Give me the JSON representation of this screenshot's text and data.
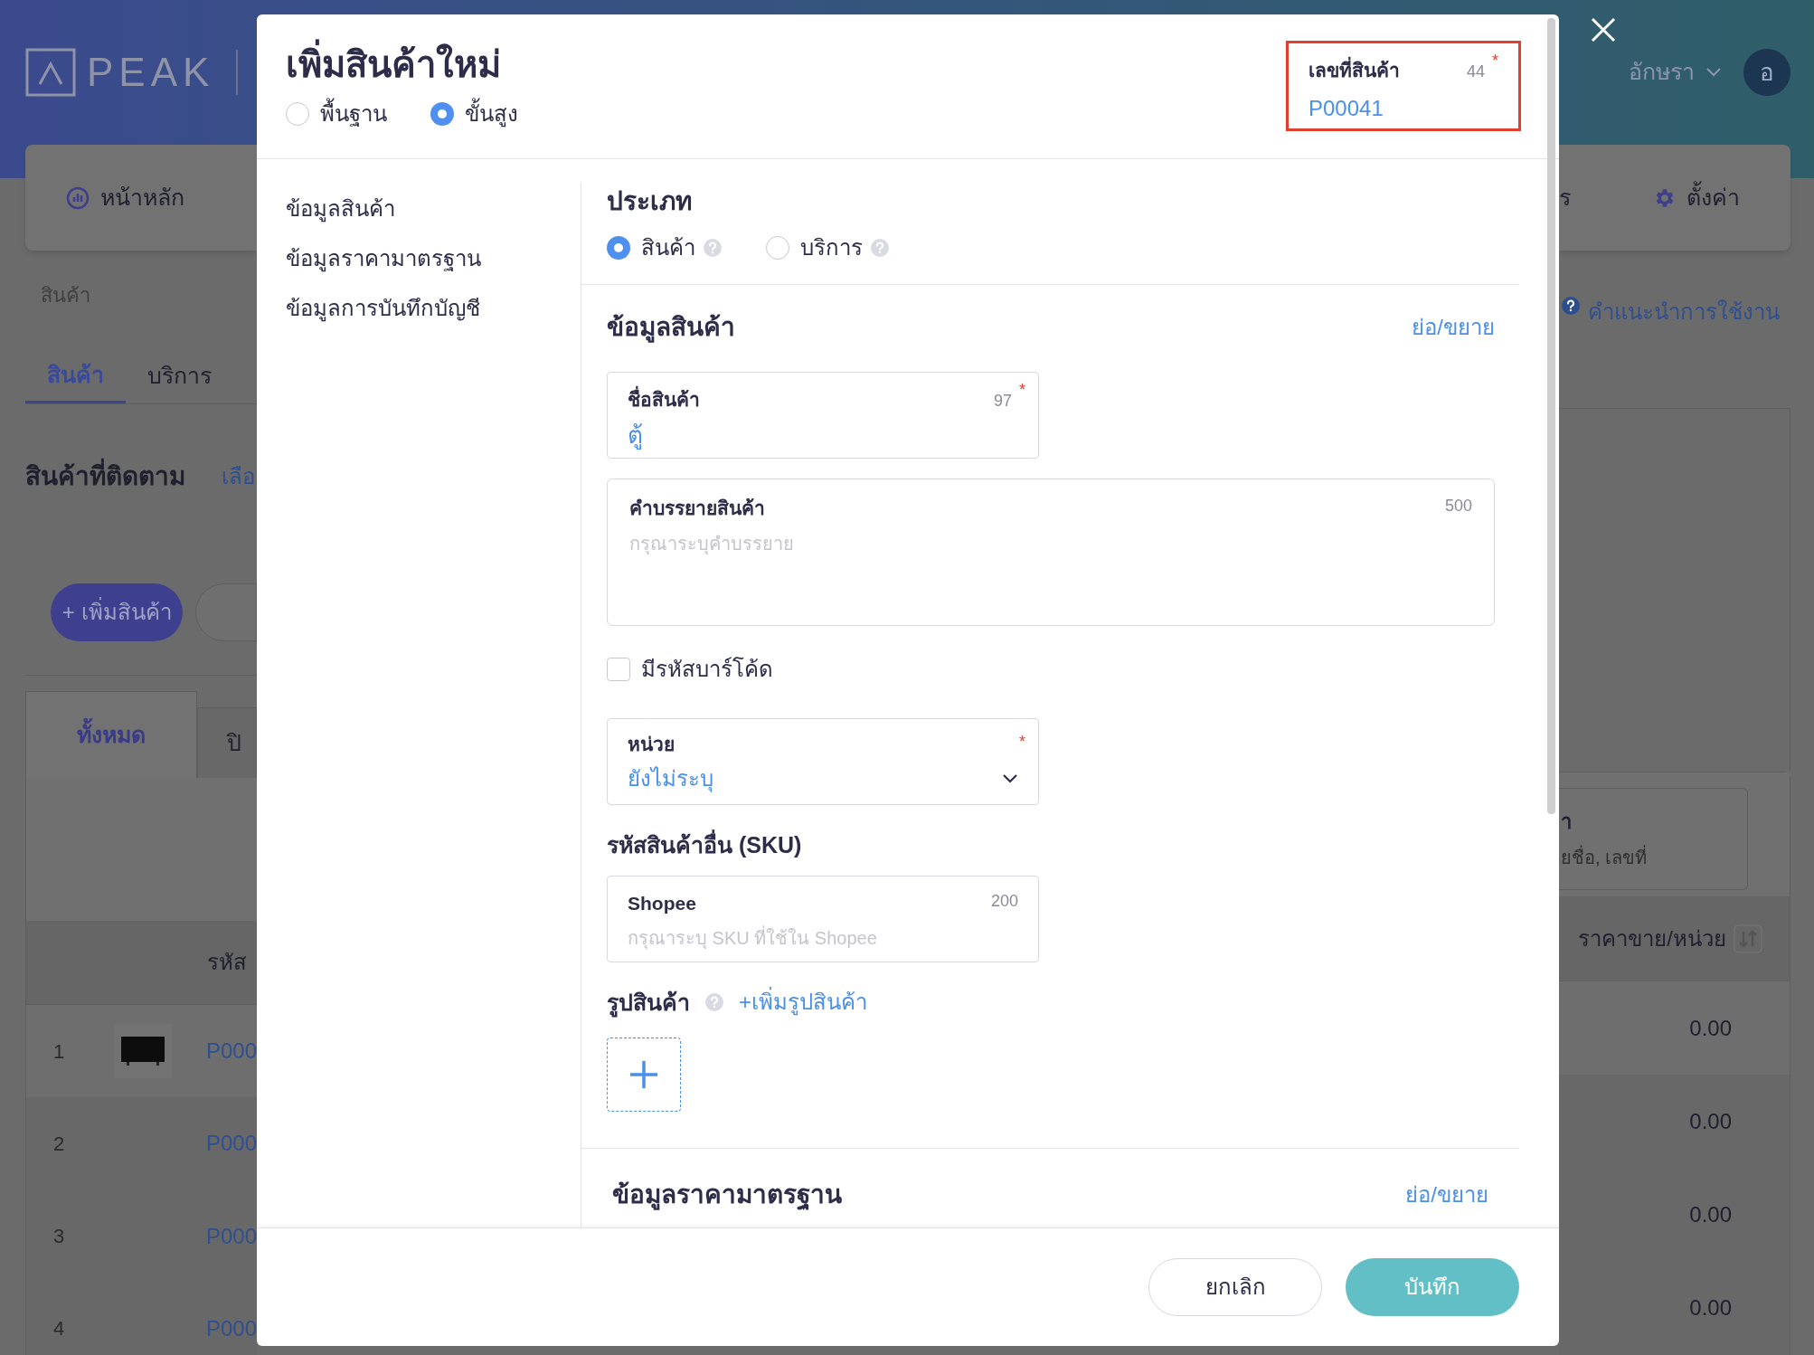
{
  "background": {
    "logo": "PEAK",
    "home": "หน้าหลัก",
    "user": {
      "name": "อักษรา",
      "initial": "อ"
    },
    "right_nav": [
      {
        "label": "ร",
        "kind": "text"
      },
      {
        "label": "ตั้งค่า",
        "kind": "settings"
      }
    ],
    "breadcrumb": "สินค้า",
    "tabs": [
      {
        "label": "สินค้า",
        "selected": true
      },
      {
        "label": "บริการ",
        "selected": false
      }
    ],
    "help_link": "คำแนะนำการใช้งาน",
    "watch_title": "สินค้าที่ติดตาม",
    "watch_link": "เลือ",
    "add_button": "+ เพิ่มสินค้า",
    "filter_tabs": [
      {
        "label": "ทั้งหมด",
        "selected": true
      },
      {
        "label": "ปิ",
        "selected": false
      }
    ],
    "search": {
      "label": "า",
      "placeholder": "ยชื่อ, เลขที่"
    },
    "table": {
      "columns": [
        "รหัส",
        "ราคาขาย/หน่วย"
      ],
      "rows": [
        {
          "index": "1",
          "code": "P000",
          "price": "0.00",
          "thumbnail": true
        },
        {
          "index": "2",
          "code": "P000",
          "price": "0.00",
          "thumbnail": false
        },
        {
          "index": "3",
          "code": "P000",
          "price": "0.00",
          "thumbnail": false
        },
        {
          "index": "4",
          "code": "P000",
          "price": "0.00",
          "thumbnail": false
        }
      ]
    }
  },
  "modal": {
    "title": "เพิ่มสินค้าใหม่",
    "modes": [
      {
        "label": "พื้นฐาน",
        "selected": false
      },
      {
        "label": "ขั้นสูง",
        "selected": true
      }
    ],
    "product_number": {
      "label": "เลขที่สินค้า",
      "count": "44",
      "required": "*",
      "value": "P00041"
    },
    "nav": [
      "ข้อมูลสินค้า",
      "ข้อมูลราคามาตรฐาน",
      "ข้อมูลการบันทึกบัญชี"
    ],
    "type": {
      "title": "ประเภท",
      "options": [
        {
          "label": "สินค้า",
          "selected": true
        },
        {
          "label": "บริการ",
          "selected": false
        }
      ]
    },
    "product_info": {
      "title": "ข้อมูลสินค้า",
      "toggle": "ย่อ/ขยาย",
      "name_field": {
        "label": "ชื่อสินค้า",
        "count": "97",
        "required": "*",
        "value": "ตู้"
      },
      "description": {
        "label": "คำบรรยายสินค้า",
        "count": "500",
        "placeholder": "กรุณาระบุคำบรรยาย"
      },
      "barcode": {
        "label": "มีรหัสบาร์โค้ด",
        "checked": false
      },
      "unit": {
        "label": "หน่วย",
        "required": "*",
        "value": "ยังไม่ระบุ"
      },
      "sku_title": "รหัสสินค้าอื่น (SKU)",
      "sku_fields": [
        {
          "label": "Shopee",
          "count": "200",
          "placeholder": "กรุณาระบุ SKU ที่ใช้ใน Shopee"
        }
      ],
      "image": {
        "title": "รูปสินค้า",
        "add_link": "+เพิ่มรูปสินค้า"
      }
    },
    "price_section": {
      "title": "ข้อมูลราคามาตรฐาน",
      "toggle": "ย่อ/ขยาย"
    },
    "footer": {
      "cancel": "ยกเลิก",
      "save": "บันทึก"
    }
  }
}
